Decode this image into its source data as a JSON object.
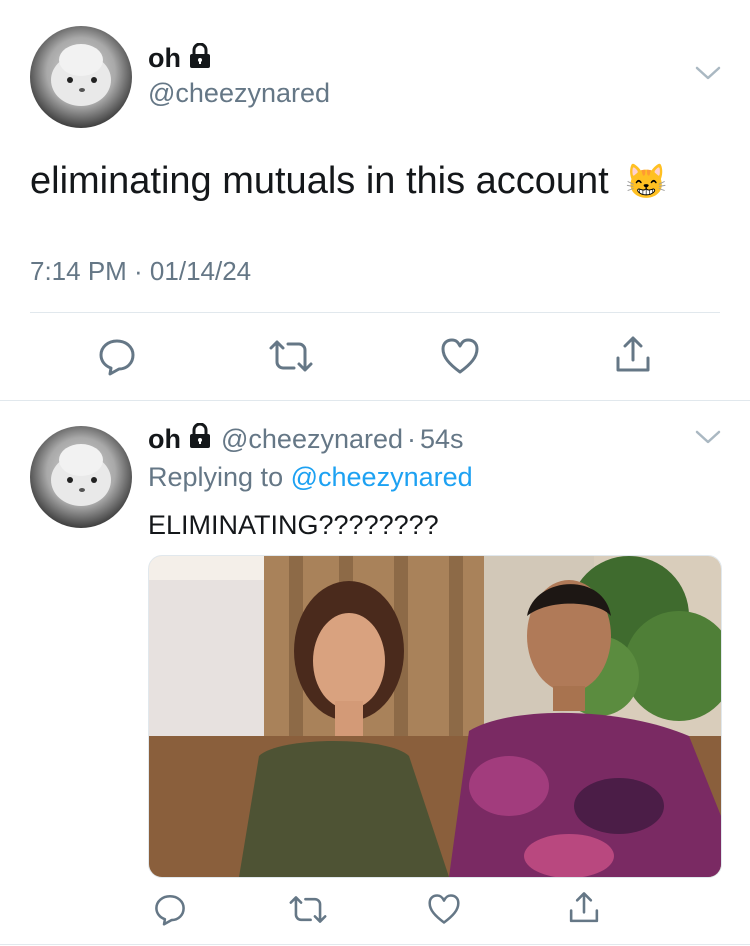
{
  "main_tweet": {
    "display_name": "oh",
    "username": "@cheezynared",
    "text": "eliminating mutuals in this account",
    "emoji": "😸",
    "timestamp": "7:14 PM · 01/14/24"
  },
  "reply": {
    "display_name": "oh",
    "username": "@cheezynared",
    "separator": "·",
    "age": "54s",
    "replying_prefix": "Replying to",
    "replying_to": "@cheezynared",
    "text": "ELIMINATING????????"
  },
  "icons": {
    "reply": "reply-icon",
    "retweet": "retweet-icon",
    "like": "heart-icon",
    "share": "share-icon",
    "lock": "lock-icon",
    "more": "chevron-down-icon"
  },
  "colors": {
    "text": "#14171a",
    "secondary": "#657786",
    "link": "#1da1f2",
    "icon": "#657786",
    "divider": "#e1e8ed"
  }
}
